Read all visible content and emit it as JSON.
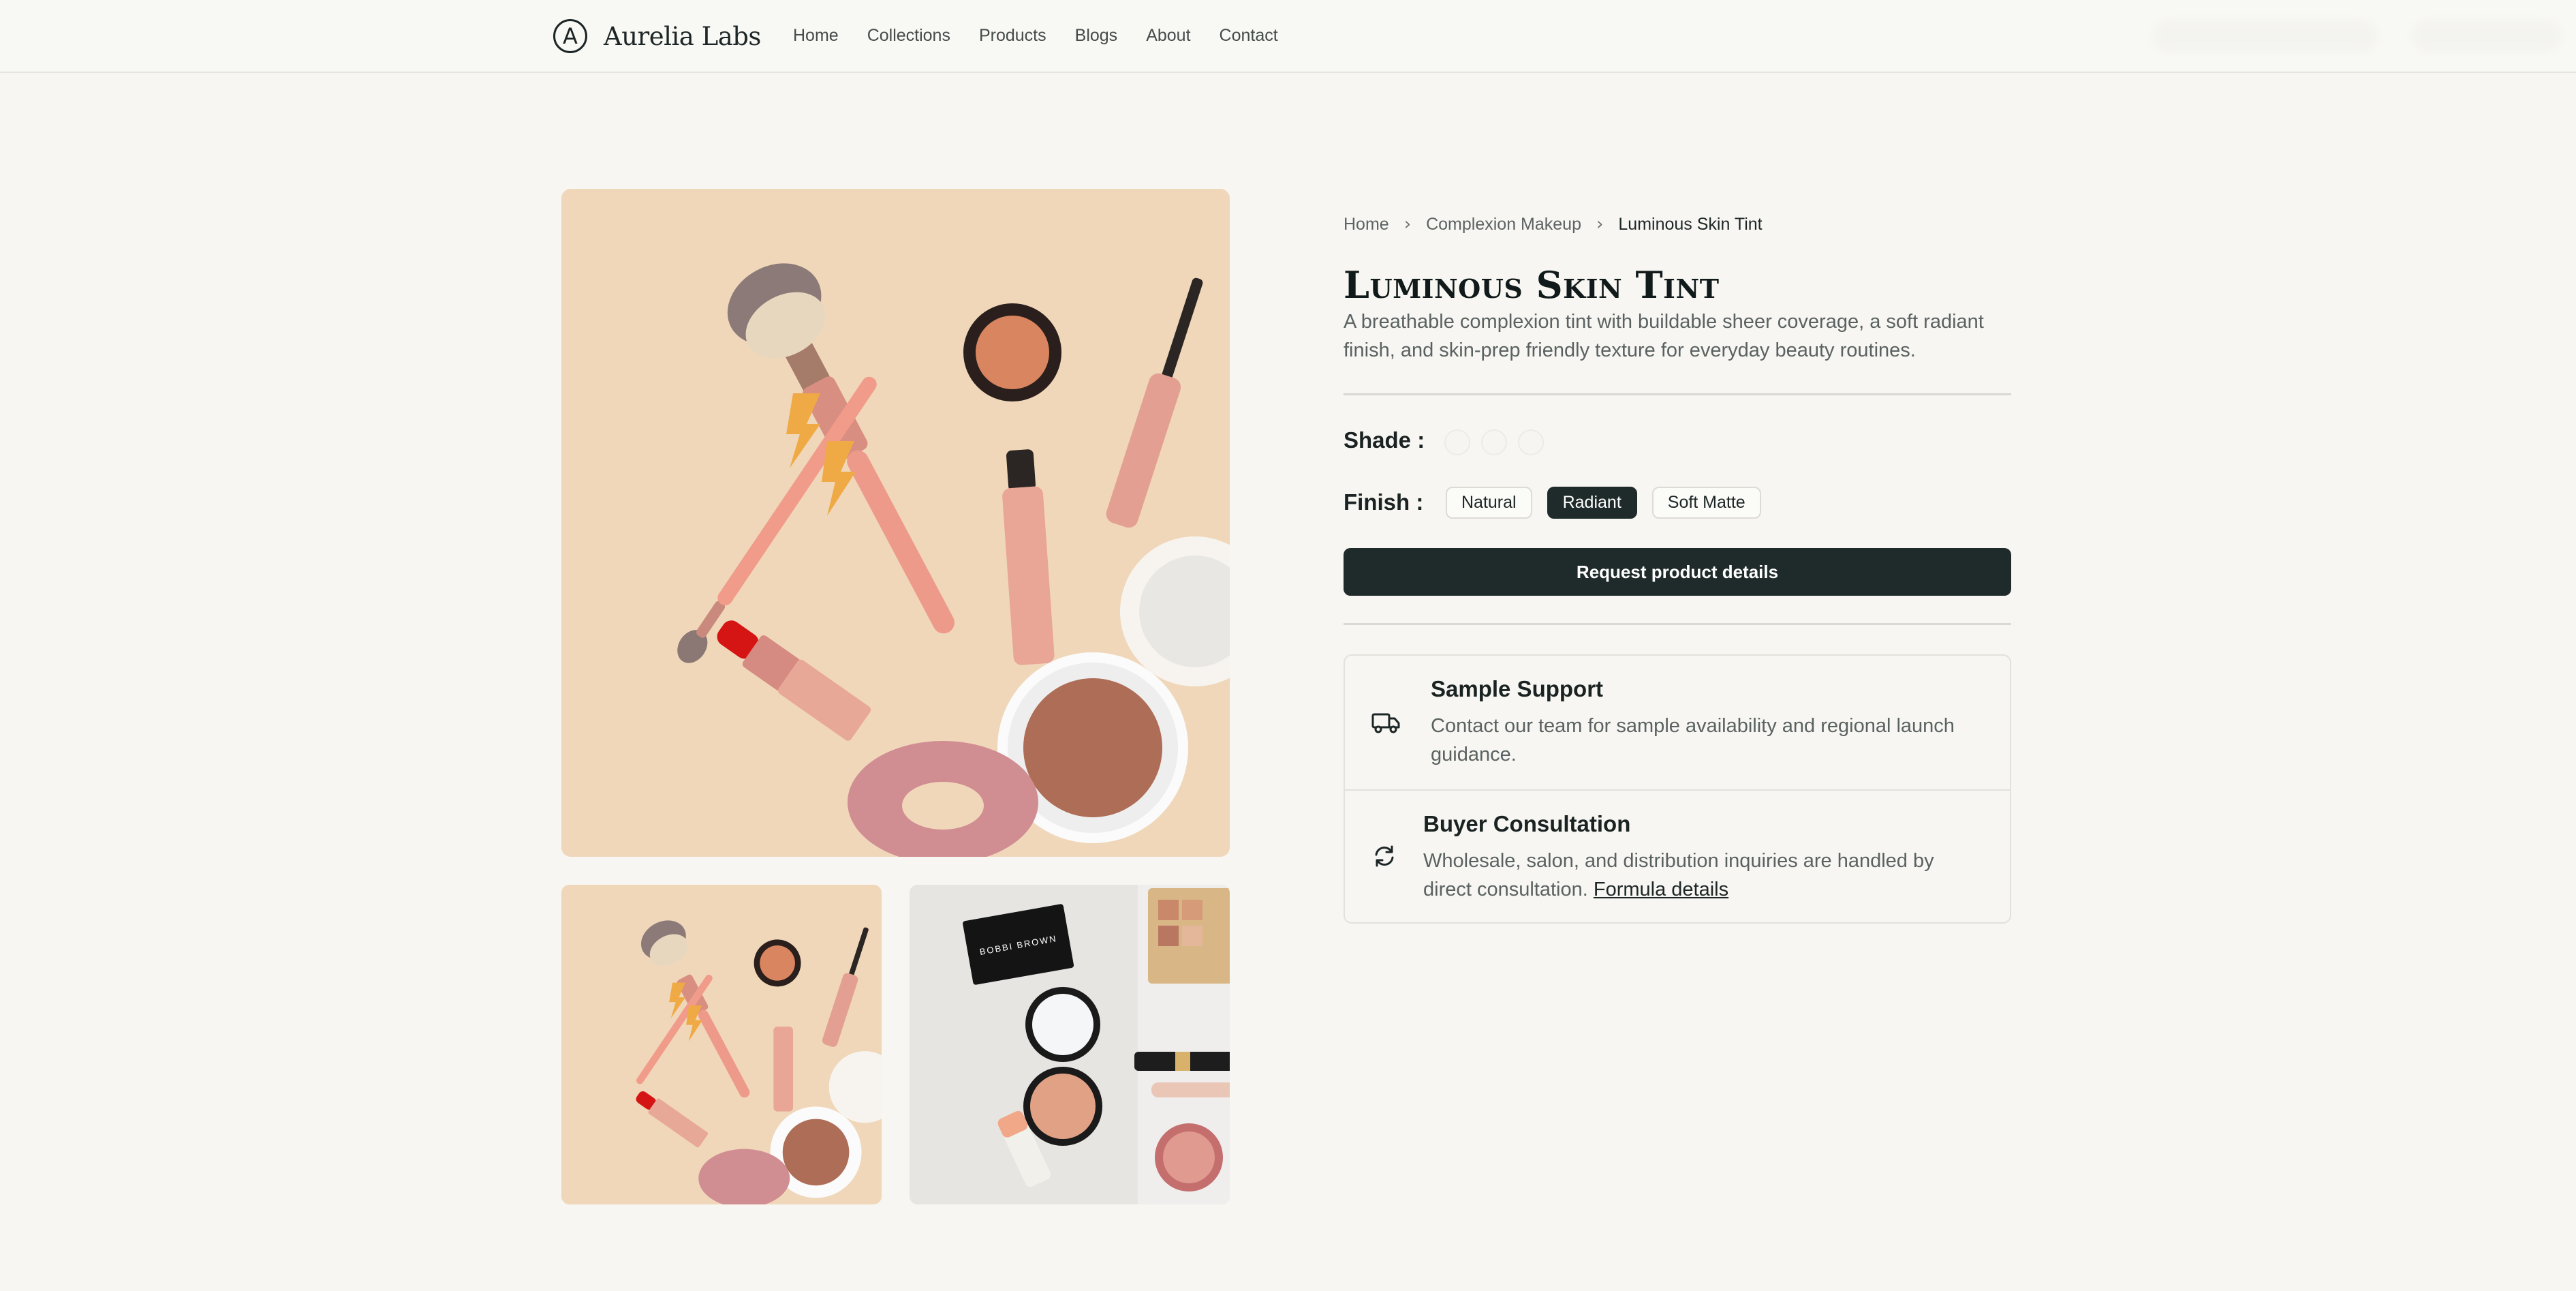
{
  "header": {
    "logo_glyph": "A",
    "brand": "Aurelia Labs",
    "nav": [
      "Home",
      "Collections",
      "Products",
      "Blogs",
      "About",
      "Contact"
    ]
  },
  "gallery": {
    "main_image": "makeup-flatlay-peach",
    "thumbnails": [
      "makeup-flatlay-peach",
      "makeup-flatlay-marble"
    ],
    "palette_brand_text": "BOBBI BROWN"
  },
  "breadcrumb": [
    "Home",
    "Complexion Makeup",
    "Luminous Skin Tint"
  ],
  "product": {
    "title": "Luminous Skin Tint",
    "description": "A breathable complexion tint with buildable sheer coverage, a soft radiant finish, and skin-prep friendly texture for everyday beauty routines."
  },
  "options": {
    "shade_label": "Shade :",
    "shade_swatch_count": 3,
    "finish_label": "Finish :",
    "finishes": [
      "Natural",
      "Radiant",
      "Soft Matte"
    ],
    "selected_finish": "Radiant"
  },
  "cta": {
    "label": "Request product details"
  },
  "info": {
    "sample": {
      "icon": "truck-icon",
      "title": "Sample Support",
      "text": "Contact our team for sample availability and regional launch guidance."
    },
    "consultation": {
      "icon": "refresh-icon",
      "title": "Buyer Consultation",
      "text": "Wholesale, salon, and distribution inquiries are handled by direct consultation.",
      "link": "Formula details"
    }
  },
  "colors": {
    "accent_dark": "#1f2a2a",
    "page_bg": "#f7f6f2",
    "image_peach": "#f0d7b9"
  }
}
